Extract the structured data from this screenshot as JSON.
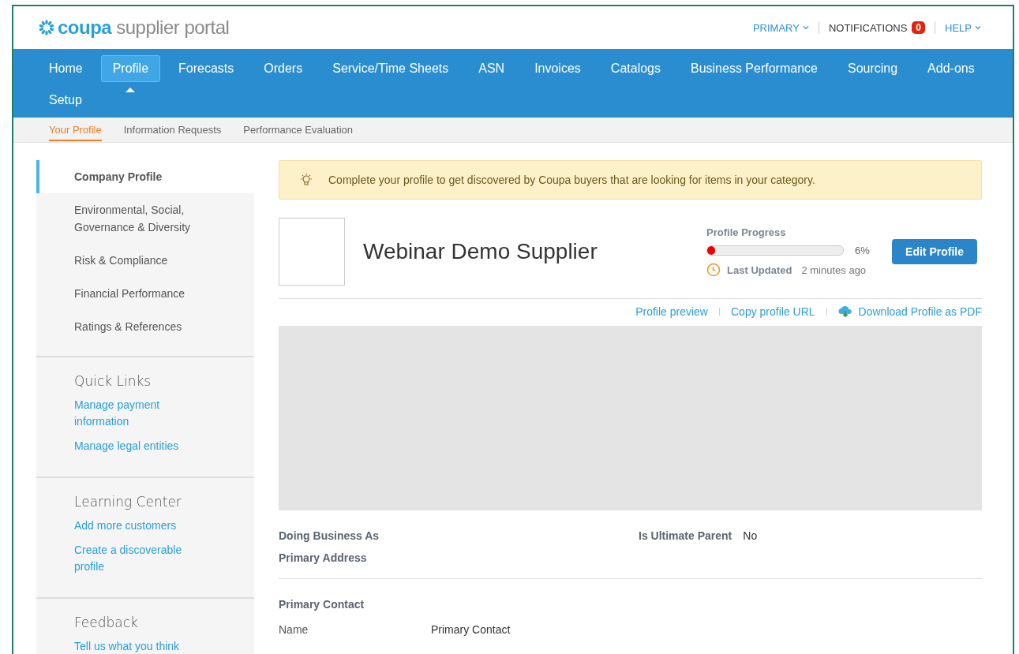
{
  "logo": {
    "brand": "coupa",
    "product": "supplier portal"
  },
  "top_links": [
    {
      "label": "PRIMARY",
      "kind": "dropdown"
    },
    {
      "label": "NOTIFICATIONS",
      "kind": "badge",
      "count": "0"
    },
    {
      "label": "HELP",
      "kind": "dropdown"
    }
  ],
  "nav": [
    {
      "label": "Home",
      "selected": false
    },
    {
      "label": "Profile",
      "selected": true
    },
    {
      "label": "Forecasts",
      "selected": false
    },
    {
      "label": "Orders",
      "selected": false
    },
    {
      "label": "Service/Time Sheets",
      "selected": false
    },
    {
      "label": "ASN",
      "selected": false
    },
    {
      "label": "Invoices",
      "selected": false
    },
    {
      "label": "Catalogs",
      "selected": false
    },
    {
      "label": "Business Performance",
      "selected": false
    },
    {
      "label": "Sourcing",
      "selected": false
    },
    {
      "label": "Add-ons",
      "selected": false
    },
    {
      "label": "Setup",
      "selected": false
    }
  ],
  "subnav": [
    {
      "label": "Your Profile",
      "selected": true
    },
    {
      "label": "Information Requests",
      "selected": false
    },
    {
      "label": "Performance Evaluation",
      "selected": false
    }
  ],
  "sidebar": {
    "items": [
      {
        "label": "Company Profile",
        "selected": true
      },
      {
        "label": "Environmental, Social, Governance & Diversity",
        "selected": false
      },
      {
        "label": "Risk & Compliance",
        "selected": false
      },
      {
        "label": "Financial Performance",
        "selected": false
      },
      {
        "label": "Ratings & References",
        "selected": false
      }
    ],
    "sections": [
      {
        "title": "Quick Links",
        "links": [
          "Manage payment information",
          "Manage legal entities"
        ]
      },
      {
        "title": "Learning Center",
        "links": [
          "Add more customers",
          "Create a discoverable profile"
        ]
      },
      {
        "title": "Feedback",
        "links": [
          "Tell us what you think"
        ]
      }
    ]
  },
  "banner": "Complete your profile to get discovered by Coupa buyers that are looking for items in your category.",
  "company": {
    "name": "Webinar Demo Supplier",
    "progress_label": "Profile Progress",
    "level": 0.06,
    "percent": "6%",
    "updated_label": "Last Updated",
    "updated": "2 minutes ago",
    "edit_button": "Edit Profile"
  },
  "profile_links": [
    {
      "label": "Profile preview",
      "kind": "link"
    },
    {
      "label": "Copy profile URL",
      "kind": "link"
    },
    {
      "label": "Download Profile as PDF",
      "kind": "download"
    }
  ],
  "details": [
    {
      "label": "Doing Business As"
    },
    {
      "label": "Is Ultimate Parent",
      "value": "No"
    },
    {
      "label": "Primary Address"
    }
  ],
  "contact": {
    "title": "Primary Contact",
    "fields": [
      {
        "label": "Name",
        "value": "Primary Contact"
      }
    ]
  }
}
